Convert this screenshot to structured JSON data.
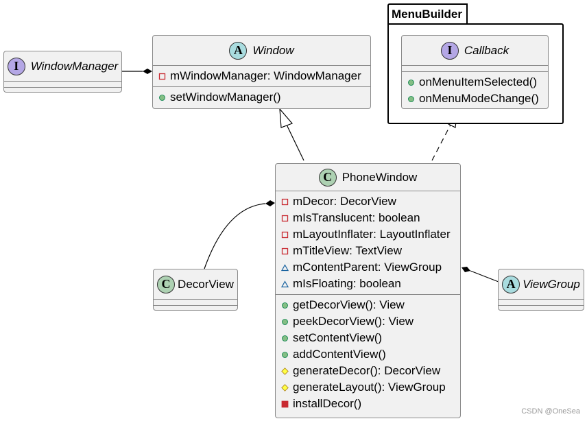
{
  "diagram": {
    "type": "uml-class-diagram",
    "colors": {
      "class_fill": "#f1f1f1",
      "class_border": "#8a8a8a",
      "interface_badge": "#b4a7e5",
      "abstract_badge": "#a9dcdf",
      "class_badge": "#add1b2",
      "private_field": "#c82930",
      "public_method": "#84be84",
      "package_field": "#1963a0",
      "protected_method": "#ffff44",
      "private_method": "#c82930"
    },
    "package": {
      "name": "MenuBuilder"
    },
    "classes": {
      "windowmanager": {
        "kind": "I",
        "name": "WindowManager",
        "italic": true,
        "fields": [],
        "methods": []
      },
      "window": {
        "kind": "A",
        "name": "Window",
        "italic": true,
        "fields": [
          {
            "visibility": "private",
            "text": "mWindowManager: WindowManager"
          }
        ],
        "methods": [
          {
            "visibility": "public",
            "text": "setWindowManager()"
          }
        ]
      },
      "callback": {
        "kind": "I",
        "name": "Callback",
        "italic": true,
        "fields": [],
        "methods": [
          {
            "visibility": "public",
            "text": "onMenuItemSelected()"
          },
          {
            "visibility": "public",
            "text": "onMenuModeChange()"
          }
        ]
      },
      "phonewindow": {
        "kind": "C",
        "name": "PhoneWindow",
        "italic": false,
        "fields": [
          {
            "visibility": "private",
            "text": "mDecor: DecorView"
          },
          {
            "visibility": "private",
            "text": "mIsTranslucent: boolean"
          },
          {
            "visibility": "private",
            "text": "mLayoutInflater: LayoutInflater"
          },
          {
            "visibility": "private",
            "text": "mTitleView: TextView"
          },
          {
            "visibility": "package",
            "text": "mContentParent: ViewGroup"
          },
          {
            "visibility": "package",
            "text": "mIsFloating: boolean"
          }
        ],
        "methods": [
          {
            "visibility": "public",
            "text": "getDecorView(): View"
          },
          {
            "visibility": "public",
            "text": "peekDecorView(): View"
          },
          {
            "visibility": "public",
            "text": "setContentView()"
          },
          {
            "visibility": "public",
            "text": "addContentView()"
          },
          {
            "visibility": "protected",
            "text": "generateDecor(): DecorView"
          },
          {
            "visibility": "protected",
            "text": "generateLayout(): ViewGroup"
          },
          {
            "visibility": "private-method",
            "text": "installDecor()"
          }
        ]
      },
      "decorview": {
        "kind": "C",
        "name": "DecorView",
        "italic": false,
        "fields": [],
        "methods": []
      },
      "viewgroup": {
        "kind": "A",
        "name": "ViewGroup",
        "italic": true,
        "fields": [],
        "methods": []
      }
    },
    "relations": [
      {
        "from": "WindowManager",
        "to": "Window",
        "type": "composition"
      },
      {
        "from": "PhoneWindow",
        "to": "Window",
        "type": "extends"
      },
      {
        "from": "PhoneWindow",
        "to": "Callback",
        "type": "implements"
      },
      {
        "from": "DecorView",
        "to": "PhoneWindow",
        "type": "composition"
      },
      {
        "from": "ViewGroup",
        "to": "PhoneWindow",
        "type": "composition"
      }
    ]
  },
  "watermark": "CSDN @OneSea"
}
